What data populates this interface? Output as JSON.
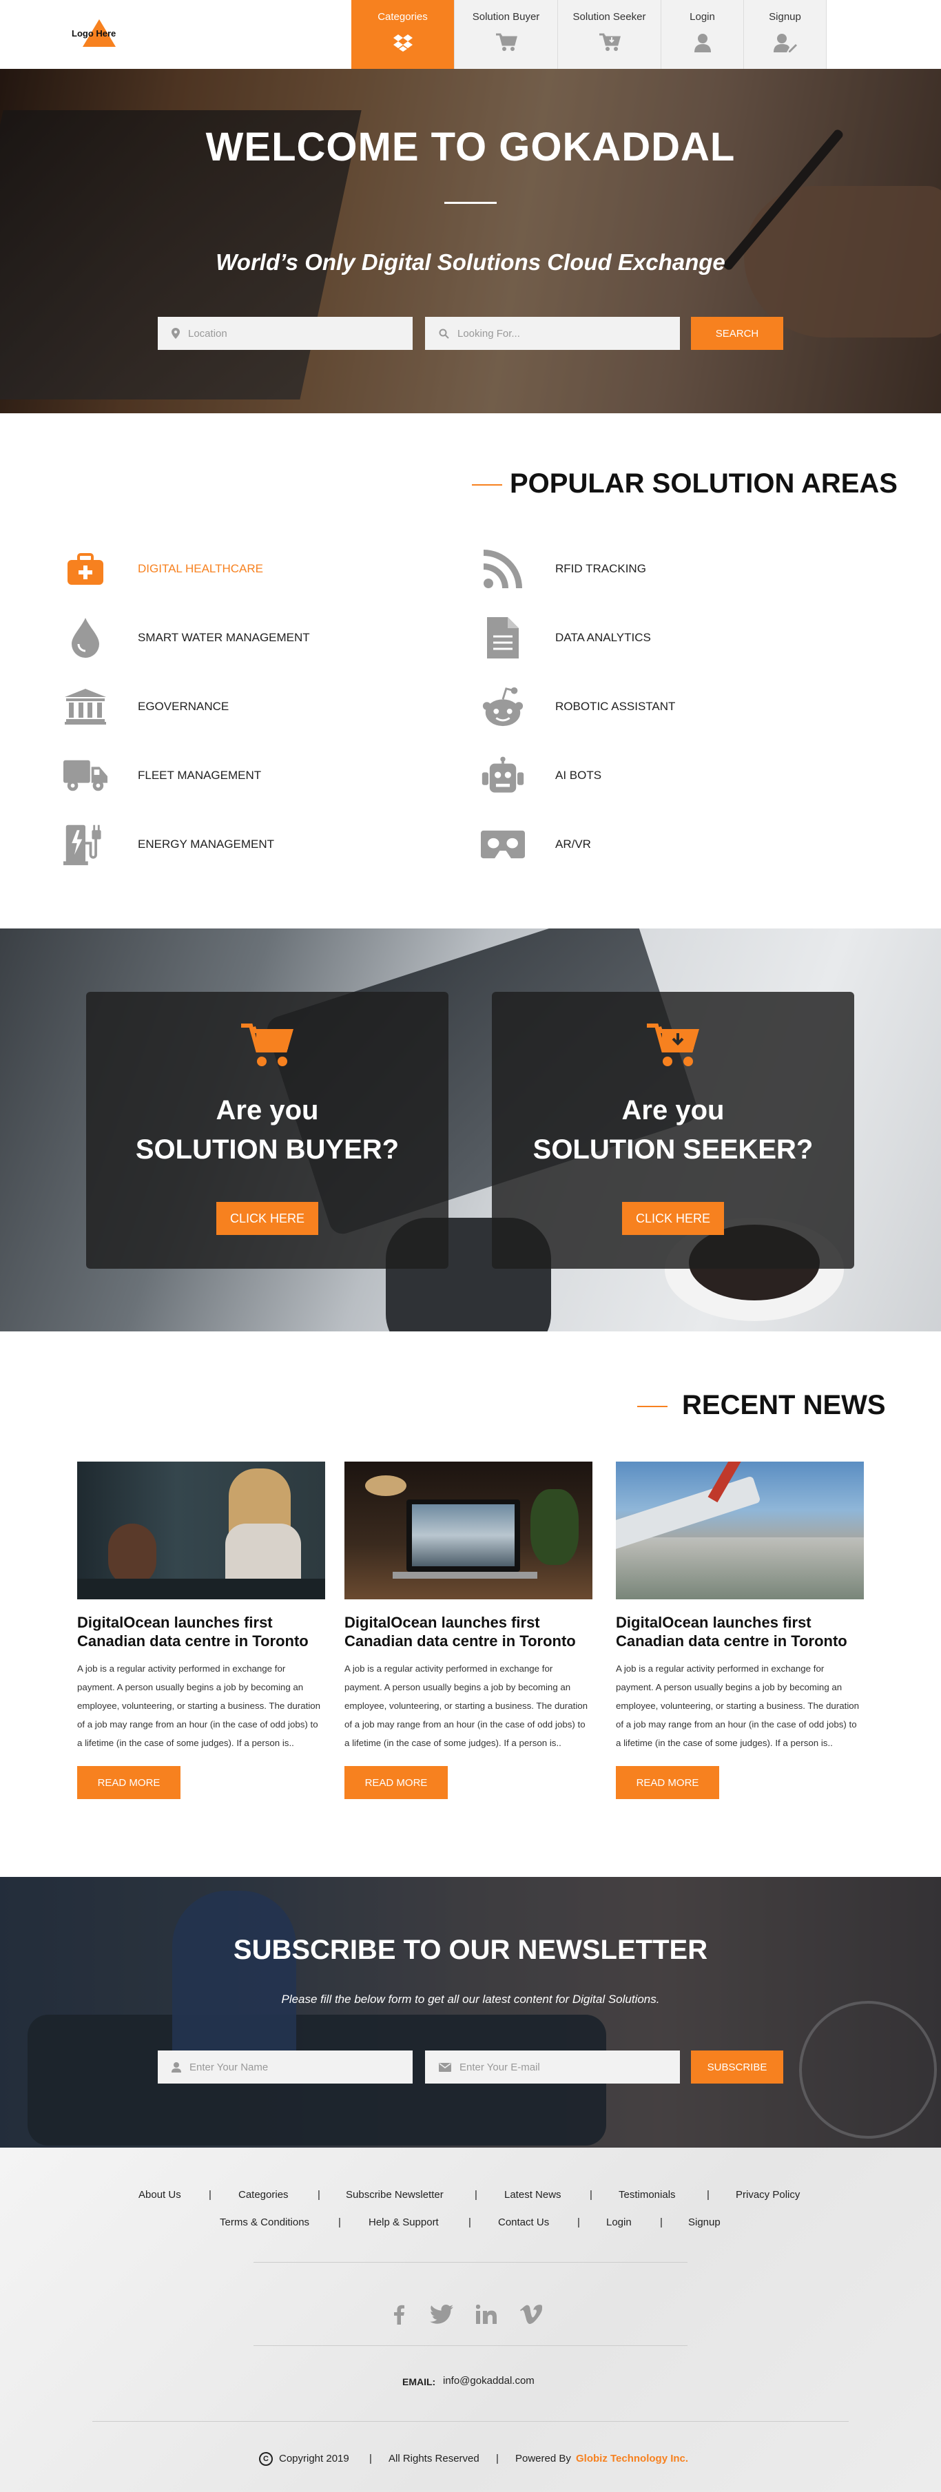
{
  "header": {
    "logo_text": "Logo Here",
    "nav": [
      {
        "label": "Categories",
        "icon": "dropbox-icon",
        "active": true
      },
      {
        "label": "Solution Buyer",
        "icon": "cart-icon"
      },
      {
        "label": "Solution Seeker",
        "icon": "cart-download-icon"
      },
      {
        "label": "Login",
        "icon": "user-icon"
      },
      {
        "label": "Signup",
        "icon": "user-edit-icon"
      }
    ]
  },
  "hero": {
    "title": "WELCOME TO GOKADDAL",
    "subtitle": "World’s Only Digital Solutions Cloud Exchange",
    "location_placeholder": "Location",
    "looking_placeholder": "Looking For...",
    "search_label": "SEARCH"
  },
  "popular": {
    "title": "POPULAR SOLUTION AREAS",
    "left": [
      {
        "label": "DIGITAL HEALTHCARE",
        "icon": "medkit-icon",
        "active": true
      },
      {
        "label": "SMART WATER MANAGEMENT",
        "icon": "water-drop-icon"
      },
      {
        "label": "EGOVERNANCE",
        "icon": "government-building-icon"
      },
      {
        "label": "FLEET MANAGEMENT",
        "icon": "truck-icon"
      },
      {
        "label": "ENERGY MANAGEMENT",
        "icon": "ev-charging-icon"
      }
    ],
    "right": [
      {
        "label": "RFID TRACKING",
        "icon": "rss-icon"
      },
      {
        "label": "DATA ANALYTICS",
        "icon": "document-icon"
      },
      {
        "label": "ROBOTIC ASSISTANT",
        "icon": "reddit-icon"
      },
      {
        "label": "AI BOTS",
        "icon": "robot-icon"
      },
      {
        "label": "AR/VR",
        "icon": "vr-headset-icon"
      }
    ]
  },
  "buyer_seeker": {
    "buyer": {
      "line1": "Are you",
      "line2": "SOLUTION BUYER?",
      "button": "CLICK HERE"
    },
    "seeker": {
      "line1": "Are you",
      "line2": "SOLUTION SEEKER?",
      "button": "CLICK HERE"
    }
  },
  "news": {
    "title": "RECENT NEWS",
    "items": [
      {
        "title": "DigitalOcean launches first Canadian data centre in Toronto",
        "body": "A job is a regular activity performed in exchange for payment. A person usually begins a job by becoming an employee, volunteering, or starting a business. The duration of a job may range from an hour (in the case of odd jobs) to a lifetime (in the case of some judges). If a person is..",
        "button": "READ MORE"
      },
      {
        "title": "DigitalOcean launches first Canadian data centre in Toronto",
        "body": "A job is a regular activity performed in exchange for payment. A person usually begins a job by becoming an employee, volunteering, or starting a business. The duration of a job may range from an hour (in the case of odd jobs) to a lifetime (in the case of some judges). If a person is..",
        "button": "READ MORE"
      },
      {
        "title": "DigitalOcean launches first Canadian data centre in Toronto",
        "body": "A job is a regular activity performed in exchange for payment. A person usually begins a job by becoming an employee, volunteering, or starting a business. The duration of a job may range from an hour (in the case of odd jobs) to a lifetime (in the case of some judges). If a person is..",
        "button": "READ MORE"
      }
    ]
  },
  "newsletter": {
    "title": "SUBSCRIBE TO OUR NEWSLETTER",
    "subtitle": "Please fill the below form to get all our latest content for Digital Solutions.",
    "name_placeholder": "Enter Your Name",
    "email_placeholder": "Enter Your E-mail",
    "button": "SUBSCRIBE"
  },
  "footer": {
    "links_row1": [
      "About Us",
      "Categories",
      "Subscribe Newsletter",
      "Latest News",
      "Testimonials",
      "Privacy Policy"
    ],
    "links_row2": [
      "Terms & Conditions",
      "Help & Support",
      "Contact Us",
      "Login",
      "Signup"
    ],
    "separator": "|",
    "social": [
      "facebook-icon",
      "twitter-icon",
      "linkedin-icon",
      "vimeo-icon"
    ],
    "email_label": "EMAIL:",
    "email_value": "info@gokaddal.com",
    "copyright_symbol": "C",
    "copyright": "Copyright 2019",
    "rights": "All Rights Reserved",
    "powered_by": "Powered By",
    "company": "Globiz Technology Inc."
  },
  "colors": {
    "accent": "#f7811f",
    "icon_gray": "#9a9a9a"
  }
}
